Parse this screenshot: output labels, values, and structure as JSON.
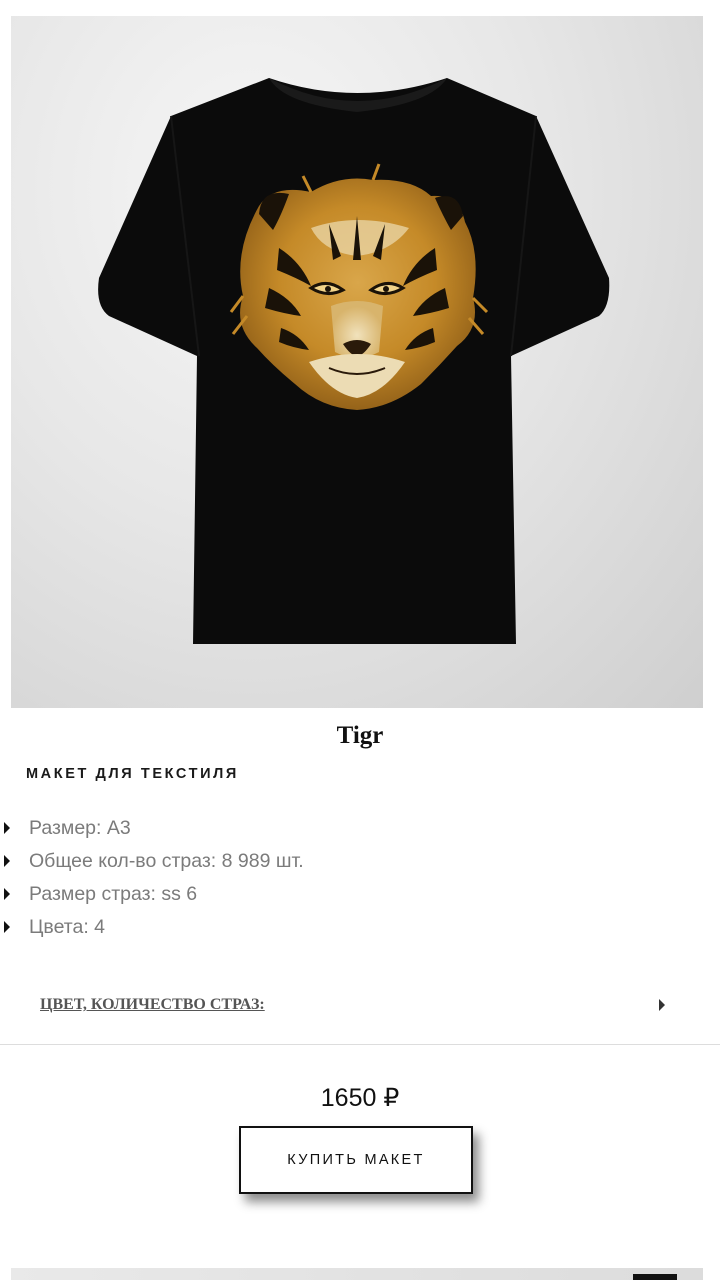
{
  "product": {
    "image_icon": "tshirt-tiger-illustration",
    "title": "Tigr",
    "subtitle": "МАКЕТ ДЛЯ ТЕКСТИЛЯ",
    "specs": [
      "Размер: А3",
      "Общее кол-во страз: 8 989 шт.",
      "Размер страз: ss 6",
      "Цвета: 4"
    ],
    "accordion_label": "ЦВЕТ, КОЛИЧЕСТВО СТРАЗ:",
    "accordion_icon": "triangle-right-icon",
    "price": "1650 ₽",
    "buy_label": "КУПИТЬ МАКЕТ"
  },
  "colors": {
    "shirt": "#0b0b0b",
    "tiger_gold": "#c9922a",
    "tiger_light": "#e8d3a3",
    "tiger_stripes": "#1a1208",
    "background": "#ffffff",
    "spec_text": "#7b7b7b"
  }
}
